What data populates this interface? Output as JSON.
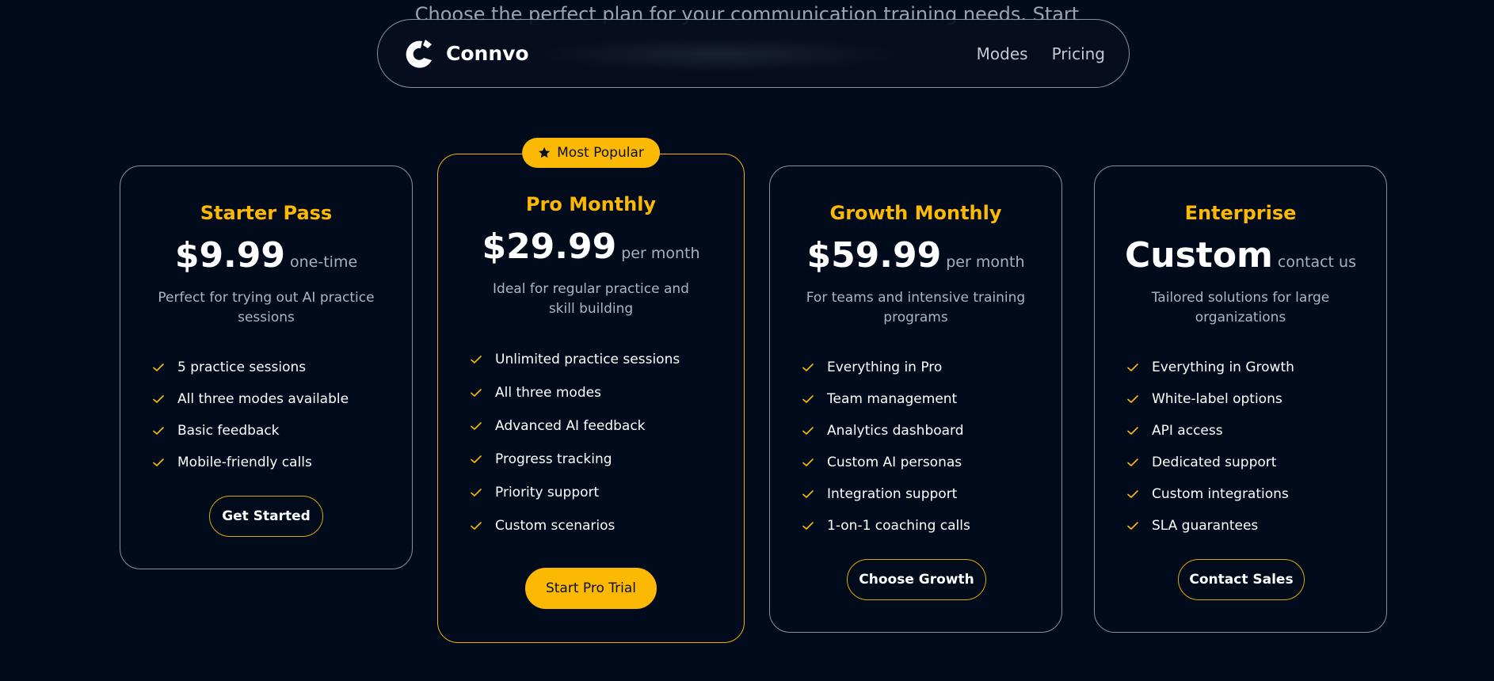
{
  "hero": {
    "subtitle": "Choose the perfect plan for your communication training needs. Start"
  },
  "nav": {
    "brand": "Connvo",
    "links": [
      "Modes",
      "Pricing"
    ]
  },
  "colors": {
    "background": "#020b1c",
    "accent": "#fbb904",
    "border": "#8a909c"
  },
  "plans": [
    {
      "name": "Starter Pass",
      "price": "$9.99",
      "period": "one-time",
      "description": "Perfect for trying out AI practice sessions",
      "features": [
        "5 practice sessions",
        "All three modes available",
        "Basic feedback",
        "Mobile-friendly calls"
      ],
      "cta": "Get Started"
    },
    {
      "badge": "Most Popular",
      "name": "Pro Monthly",
      "price": "$29.99",
      "period": "per month",
      "description": "Ideal for regular practice and skill building",
      "features": [
        "Unlimited practice sessions",
        "All three modes",
        "Advanced AI feedback",
        "Progress tracking",
        "Priority support",
        "Custom scenarios"
      ],
      "cta": "Start Pro Trial"
    },
    {
      "name": "Growth Monthly",
      "price": "$59.99",
      "period": "per month",
      "description": "For teams and intensive training programs",
      "features": [
        "Everything in Pro",
        "Team management",
        "Analytics dashboard",
        "Custom AI personas",
        "Integration support",
        "1-on-1 coaching calls"
      ],
      "cta": "Choose Growth"
    },
    {
      "name": "Enterprise",
      "price": "Custom",
      "period": "contact us",
      "description": "Tailored solutions for large organizations",
      "features": [
        "Everything in Growth",
        "White-label options",
        "API access",
        "Dedicated support",
        "Custom integrations",
        "SLA guarantees"
      ],
      "cta": "Contact Sales"
    }
  ]
}
